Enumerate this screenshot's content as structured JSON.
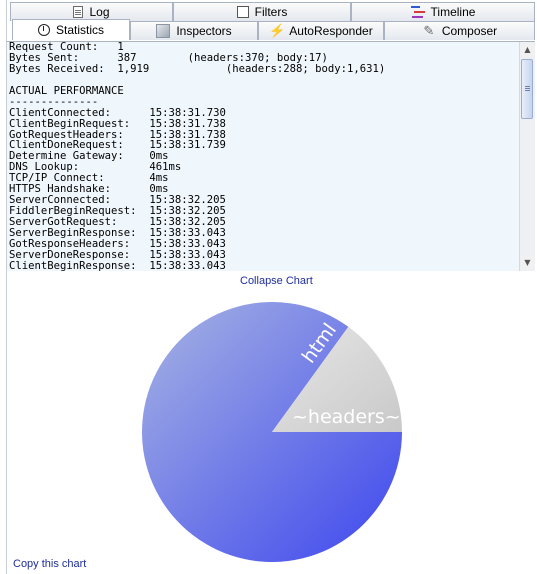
{
  "tabs_row1": [
    {
      "label": "Log",
      "icon": "log-icon"
    },
    {
      "label": "Filters",
      "icon": "checkbox-icon"
    },
    {
      "label": "Timeline",
      "icon": "timeline-icon"
    }
  ],
  "tabs_row2": [
    {
      "label": "Statistics",
      "icon": "stopwatch-icon",
      "active": true
    },
    {
      "label": "Inspectors",
      "icon": "inspectors-icon"
    },
    {
      "label": "AutoResponder",
      "icon": "lightning-icon"
    },
    {
      "label": "Composer",
      "icon": "pencil-icon"
    }
  ],
  "stats_lines": [
    "Request Count:   1",
    "Bytes Sent:      387        (headers:370; body:17)",
    "Bytes Received:  1,919            (headers:288; body:1,631)",
    "",
    "ACTUAL PERFORMANCE",
    "--------------",
    "ClientConnected:      15:38:31.730",
    "ClientBeginRequest:   15:38:31.738",
    "GotRequestHeaders:    15:38:31.738",
    "ClientDoneRequest:    15:38:31.739",
    "Determine Gateway:    0ms",
    "DNS Lookup:           461ms",
    "TCP/IP Connect:       4ms",
    "HTTPS Handshake:      0ms",
    "ServerConnected:      15:38:32.205",
    "FiddlerBeginRequest:  15:38:32.205",
    "ServerGotRequest:     15:38:32.205",
    "ServerBeginResponse:  15:38:33.043",
    "GotResponseHeaders:   15:38:33.043",
    "ServerDoneResponse:   15:38:33.043",
    "ClientBeginResponse:  15:38:33.043"
  ],
  "links": {
    "collapse": "Collapse Chart",
    "copy": "Copy this chart"
  },
  "chart_data": {
    "type": "pie",
    "slices": [
      {
        "label": "html",
        "value": 1631,
        "color": "#4f5ee8"
      },
      {
        "label": "~headers~",
        "value": 288,
        "color": "#d4d4d4"
      }
    ]
  }
}
